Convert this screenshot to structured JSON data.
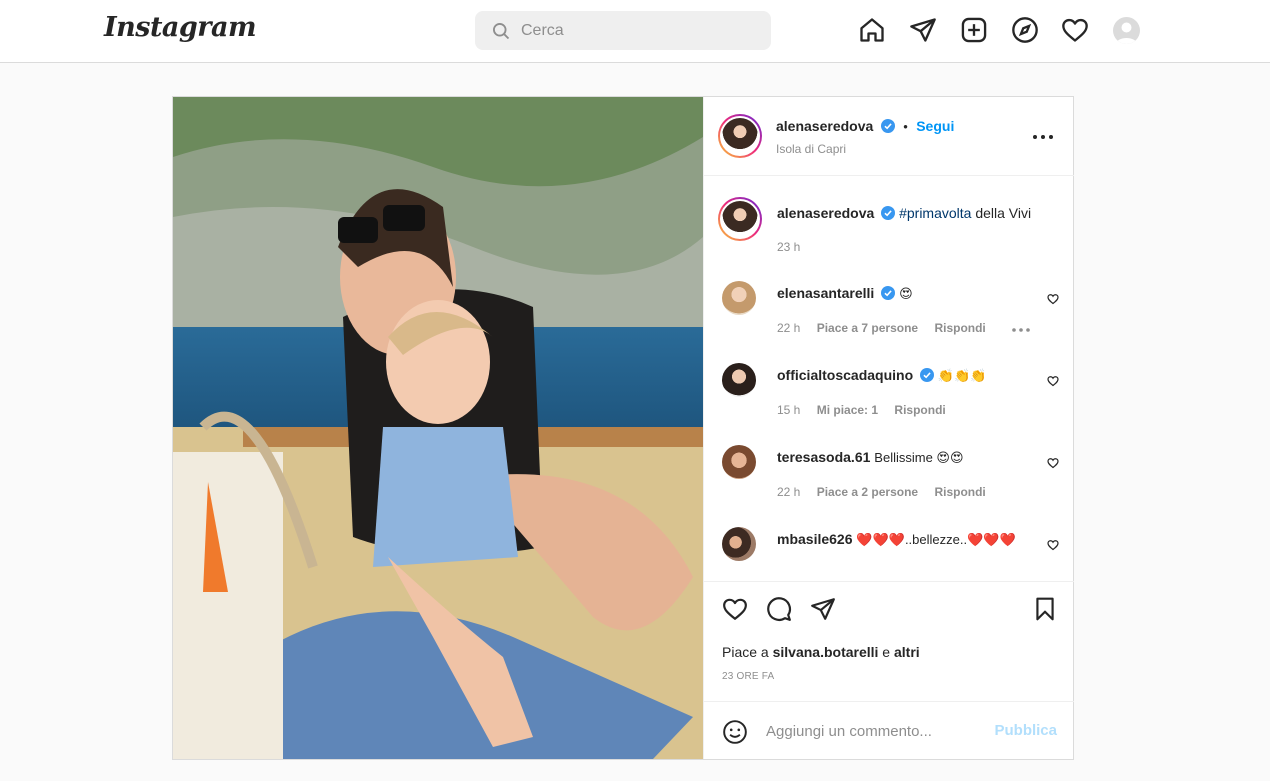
{
  "nav": {
    "logo": "Instagram",
    "search_placeholder": "Cerca",
    "icons": [
      "home-icon",
      "direct-icon",
      "new-post-icon",
      "explore-icon",
      "activity-heart-icon",
      "profile-avatar"
    ]
  },
  "post": {
    "author": "alenaseredova",
    "follow_dot": "•",
    "follow_label": "Segui",
    "location": "Isola di Capri",
    "caption": {
      "username": "alenaseredova",
      "hashtag": "#primavolta",
      "text": " della Vivi",
      "time": "23 h"
    },
    "comments": [
      {
        "username": "elenasantarelli",
        "verified": true,
        "text": "😍",
        "time": "22 h",
        "likes": "Piace a 7 persone",
        "reply": "Rispondi",
        "show_more": true
      },
      {
        "username": "officialtoscadaquino",
        "verified": true,
        "text": "👏👏👏",
        "time": "15 h",
        "likes": "Mi piace: 1",
        "reply": "Rispondi",
        "show_more": false
      },
      {
        "username": "teresasoda.61",
        "verified": false,
        "text": "Bellissime 😍😍",
        "time": "22 h",
        "likes": "Piace a 2 persone",
        "reply": "Rispondi",
        "show_more": false
      },
      {
        "username": "mbasile626",
        "verified": false,
        "text": "❤️❤️❤️..bellezze..❤️❤️❤️",
        "time": "",
        "likes": "",
        "reply": "",
        "show_more": false
      }
    ],
    "likes_prefix": "Piace a ",
    "likes_user": "silvana.botarelli",
    "likes_mid": " e ",
    "likes_others": "altri",
    "timestamp": "23 ORE FA",
    "add_comment_placeholder": "Aggiungi un commento...",
    "publish_label": "Pubblica"
  },
  "colors": {
    "accent": "#0095f6",
    "verified": "#3897f0",
    "publish_disabled": "#b2dffc"
  }
}
